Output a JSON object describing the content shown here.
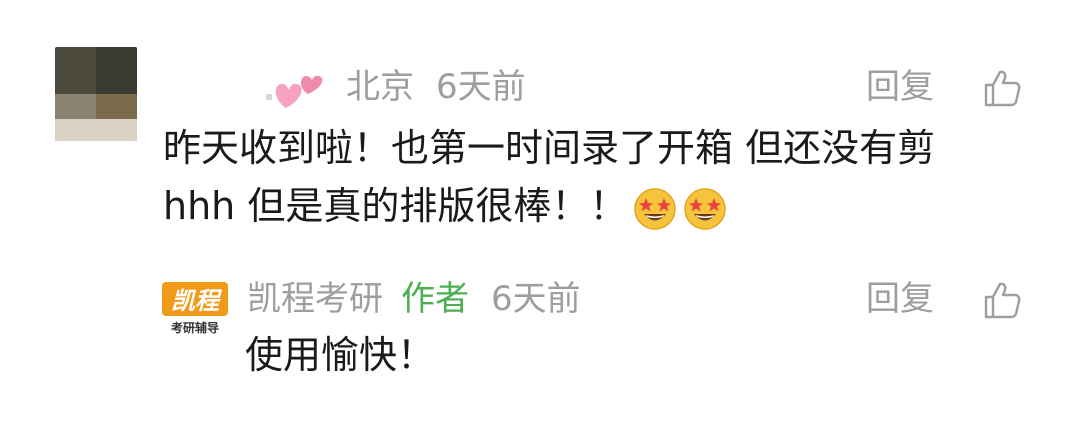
{
  "comments": [
    {
      "location": "北京",
      "time": "6天前",
      "reply_label": "回复",
      "text_line1": "昨天收到啦！也第一时间录了开箱 但还没有剪",
      "text_line2": "hhh 但是真的排版很棒！！",
      "emojis": [
        "star-struck-icon",
        "star-struck-icon"
      ]
    },
    {
      "username": "凯程考研",
      "author_tag": "作者",
      "time": "6天前",
      "reply_label": "回复",
      "text": "使用愉快！",
      "avatar_logo_main": "凯程",
      "avatar_logo_sub": "考研辅导"
    }
  ],
  "colors": {
    "meta_gray": "#9e9e9e",
    "author_green": "#4caf50",
    "text": "#1a1a1a",
    "logo_orange": "#f29a1a"
  }
}
